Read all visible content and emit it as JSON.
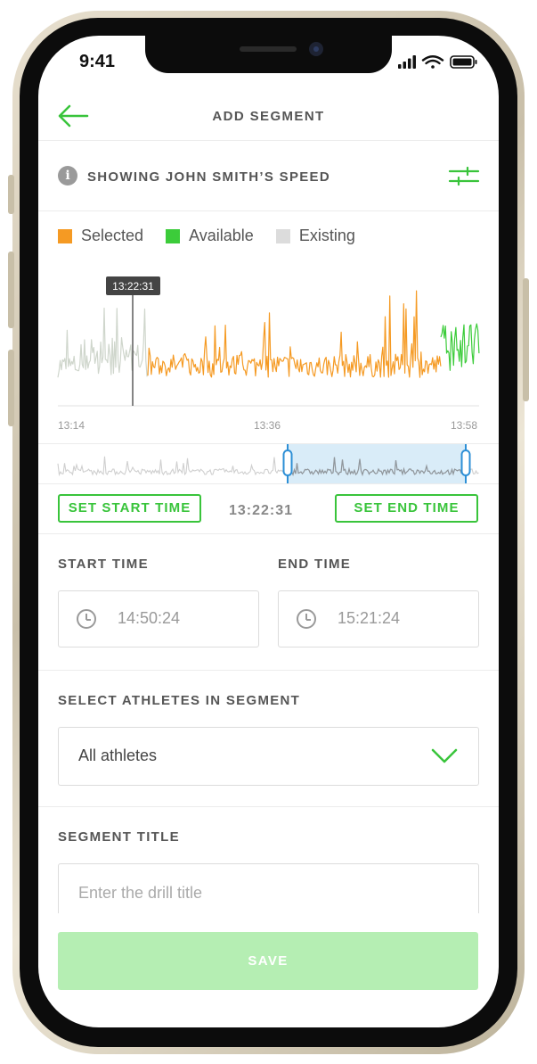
{
  "status_bar": {
    "time": "9:41"
  },
  "header": {
    "title": "ADD SEGMENT"
  },
  "info_bar": {
    "text": "SHOWING JOHN SMITH’S SPEED"
  },
  "legend": [
    {
      "label": "Selected",
      "color": "#f59a23"
    },
    {
      "label": "Available",
      "color": "#3ccc3a"
    },
    {
      "label": "Existing",
      "color": "#dcdcdc"
    }
  ],
  "chart_data": {
    "type": "line",
    "x_tick_labels": [
      "13:14",
      "13:36",
      "13:58"
    ],
    "marker_label": "13:22:31",
    "series": [
      {
        "name": "Existing",
        "color": "#cfd6cc"
      },
      {
        "name": "Selected",
        "color": "#f59a23"
      },
      {
        "name": "Available",
        "color": "#3ccc3a"
      }
    ]
  },
  "timeline": {
    "set_start_label": "SET START TIME",
    "set_end_label": "SET END TIME",
    "current_time": "13:22:31"
  },
  "times": {
    "start_label": "START TIME",
    "start_value": "14:50:24",
    "end_label": "END TIME",
    "end_value": "15:21:24"
  },
  "athletes": {
    "label": "SELECT ATHLETES IN SEGMENT",
    "selected": "All athletes"
  },
  "segment_title": {
    "label": "SEGMENT TITLE",
    "placeholder": "Enter the drill title"
  },
  "save_label": "SAVE",
  "colors": {
    "accent": "#39c43b",
    "selected": "#f59a23",
    "save_disabled": "#b5eeb3"
  }
}
